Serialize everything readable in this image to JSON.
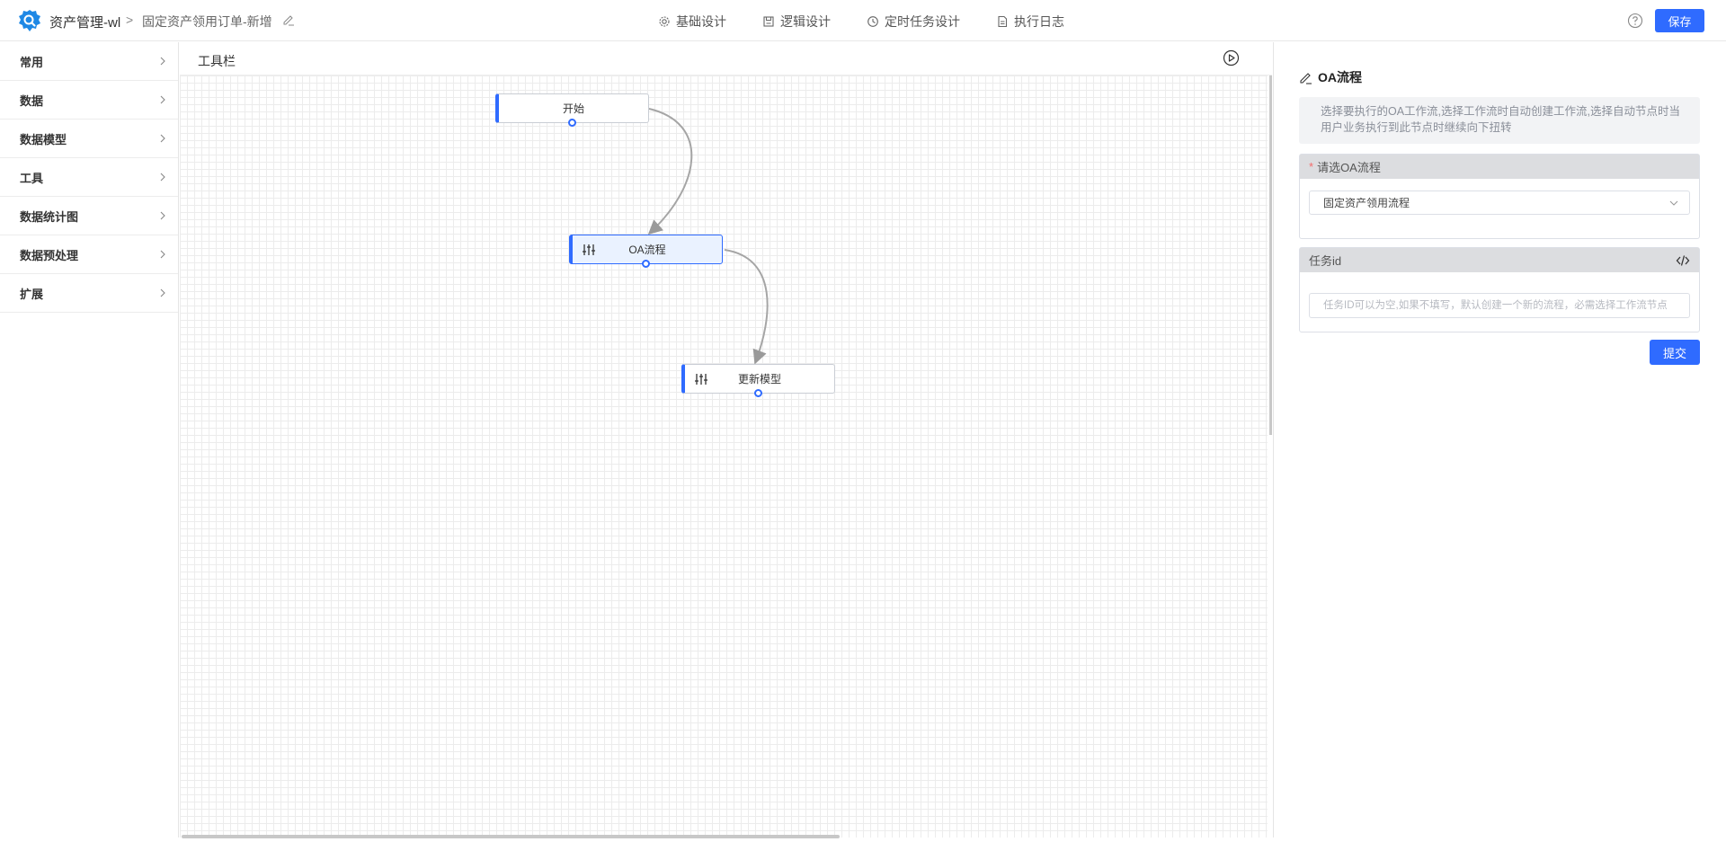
{
  "header": {
    "app_title": "资产管理-wl",
    "page_title": "固定资产领用订单-新增",
    "nav": [
      {
        "label": "基础设计",
        "icon": "gear-icon"
      },
      {
        "label": "逻辑设计",
        "icon": "save-doc-icon"
      },
      {
        "label": "定时任务设计",
        "icon": "clock-icon"
      },
      {
        "label": "执行日志",
        "icon": "file-icon"
      }
    ],
    "save_label": "保存"
  },
  "sidebar": {
    "items": [
      {
        "label": "常用"
      },
      {
        "label": "数据"
      },
      {
        "label": "数据模型"
      },
      {
        "label": "工具"
      },
      {
        "label": "数据统计图"
      },
      {
        "label": "数据预处理"
      },
      {
        "label": "扩展"
      }
    ]
  },
  "canvas": {
    "toolbar_label": "工具栏",
    "nodes": [
      {
        "label": "开始"
      },
      {
        "label": "OA流程"
      },
      {
        "label": "更新模型"
      }
    ]
  },
  "panel": {
    "title": "OA流程",
    "description": "选择要执行的OA工作流,选择工作流时自动创建工作流,选择自动节点时当用户业务执行到此节点时继续向下扭转",
    "oa_field": {
      "required_mark": "*",
      "label": "请选OA流程",
      "value": "固定资产领用流程"
    },
    "task_field": {
      "label": "任务id",
      "placeholder": "任务ID可以为空,如果不填写，默认创建一个新的流程，必需选择工作流节点"
    },
    "submit_label": "提交"
  },
  "colors": {
    "accent": "#2f6bff",
    "required": "#f56c6c"
  }
}
